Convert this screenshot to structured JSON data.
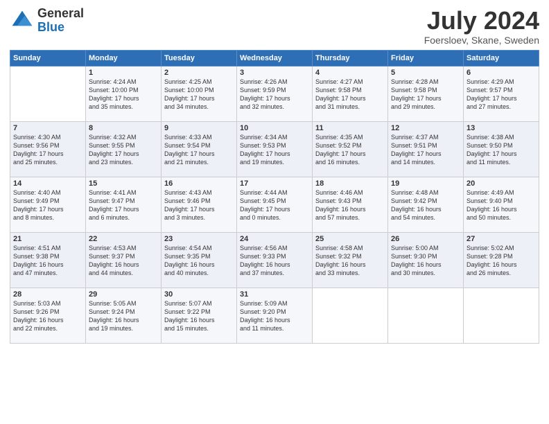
{
  "logo": {
    "line1": "General",
    "line2": "Blue"
  },
  "title": "July 2024",
  "location": "Foersloev, Skane, Sweden",
  "days_header": [
    "Sunday",
    "Monday",
    "Tuesday",
    "Wednesday",
    "Thursday",
    "Friday",
    "Saturday"
  ],
  "weeks": [
    [
      {
        "day": "",
        "info": ""
      },
      {
        "day": "1",
        "info": "Sunrise: 4:24 AM\nSunset: 10:00 PM\nDaylight: 17 hours\nand 35 minutes."
      },
      {
        "day": "2",
        "info": "Sunrise: 4:25 AM\nSunset: 10:00 PM\nDaylight: 17 hours\nand 34 minutes."
      },
      {
        "day": "3",
        "info": "Sunrise: 4:26 AM\nSunset: 9:59 PM\nDaylight: 17 hours\nand 32 minutes."
      },
      {
        "day": "4",
        "info": "Sunrise: 4:27 AM\nSunset: 9:58 PM\nDaylight: 17 hours\nand 31 minutes."
      },
      {
        "day": "5",
        "info": "Sunrise: 4:28 AM\nSunset: 9:58 PM\nDaylight: 17 hours\nand 29 minutes."
      },
      {
        "day": "6",
        "info": "Sunrise: 4:29 AM\nSunset: 9:57 PM\nDaylight: 17 hours\nand 27 minutes."
      }
    ],
    [
      {
        "day": "7",
        "info": "Sunrise: 4:30 AM\nSunset: 9:56 PM\nDaylight: 17 hours\nand 25 minutes."
      },
      {
        "day": "8",
        "info": "Sunrise: 4:32 AM\nSunset: 9:55 PM\nDaylight: 17 hours\nand 23 minutes."
      },
      {
        "day": "9",
        "info": "Sunrise: 4:33 AM\nSunset: 9:54 PM\nDaylight: 17 hours\nand 21 minutes."
      },
      {
        "day": "10",
        "info": "Sunrise: 4:34 AM\nSunset: 9:53 PM\nDaylight: 17 hours\nand 19 minutes."
      },
      {
        "day": "11",
        "info": "Sunrise: 4:35 AM\nSunset: 9:52 PM\nDaylight: 17 hours\nand 16 minutes."
      },
      {
        "day": "12",
        "info": "Sunrise: 4:37 AM\nSunset: 9:51 PM\nDaylight: 17 hours\nand 14 minutes."
      },
      {
        "day": "13",
        "info": "Sunrise: 4:38 AM\nSunset: 9:50 PM\nDaylight: 17 hours\nand 11 minutes."
      }
    ],
    [
      {
        "day": "14",
        "info": "Sunrise: 4:40 AM\nSunset: 9:49 PM\nDaylight: 17 hours\nand 8 minutes."
      },
      {
        "day": "15",
        "info": "Sunrise: 4:41 AM\nSunset: 9:47 PM\nDaylight: 17 hours\nand 6 minutes."
      },
      {
        "day": "16",
        "info": "Sunrise: 4:43 AM\nSunset: 9:46 PM\nDaylight: 17 hours\nand 3 minutes."
      },
      {
        "day": "17",
        "info": "Sunrise: 4:44 AM\nSunset: 9:45 PM\nDaylight: 17 hours\nand 0 minutes."
      },
      {
        "day": "18",
        "info": "Sunrise: 4:46 AM\nSunset: 9:43 PM\nDaylight: 16 hours\nand 57 minutes."
      },
      {
        "day": "19",
        "info": "Sunrise: 4:48 AM\nSunset: 9:42 PM\nDaylight: 16 hours\nand 54 minutes."
      },
      {
        "day": "20",
        "info": "Sunrise: 4:49 AM\nSunset: 9:40 PM\nDaylight: 16 hours\nand 50 minutes."
      }
    ],
    [
      {
        "day": "21",
        "info": "Sunrise: 4:51 AM\nSunset: 9:38 PM\nDaylight: 16 hours\nand 47 minutes."
      },
      {
        "day": "22",
        "info": "Sunrise: 4:53 AM\nSunset: 9:37 PM\nDaylight: 16 hours\nand 44 minutes."
      },
      {
        "day": "23",
        "info": "Sunrise: 4:54 AM\nSunset: 9:35 PM\nDaylight: 16 hours\nand 40 minutes."
      },
      {
        "day": "24",
        "info": "Sunrise: 4:56 AM\nSunset: 9:33 PM\nDaylight: 16 hours\nand 37 minutes."
      },
      {
        "day": "25",
        "info": "Sunrise: 4:58 AM\nSunset: 9:32 PM\nDaylight: 16 hours\nand 33 minutes."
      },
      {
        "day": "26",
        "info": "Sunrise: 5:00 AM\nSunset: 9:30 PM\nDaylight: 16 hours\nand 30 minutes."
      },
      {
        "day": "27",
        "info": "Sunrise: 5:02 AM\nSunset: 9:28 PM\nDaylight: 16 hours\nand 26 minutes."
      }
    ],
    [
      {
        "day": "28",
        "info": "Sunrise: 5:03 AM\nSunset: 9:26 PM\nDaylight: 16 hours\nand 22 minutes."
      },
      {
        "day": "29",
        "info": "Sunrise: 5:05 AM\nSunset: 9:24 PM\nDaylight: 16 hours\nand 19 minutes."
      },
      {
        "day": "30",
        "info": "Sunrise: 5:07 AM\nSunset: 9:22 PM\nDaylight: 16 hours\nand 15 minutes."
      },
      {
        "day": "31",
        "info": "Sunrise: 5:09 AM\nSunset: 9:20 PM\nDaylight: 16 hours\nand 11 minutes."
      },
      {
        "day": "",
        "info": ""
      },
      {
        "day": "",
        "info": ""
      },
      {
        "day": "",
        "info": ""
      }
    ]
  ]
}
